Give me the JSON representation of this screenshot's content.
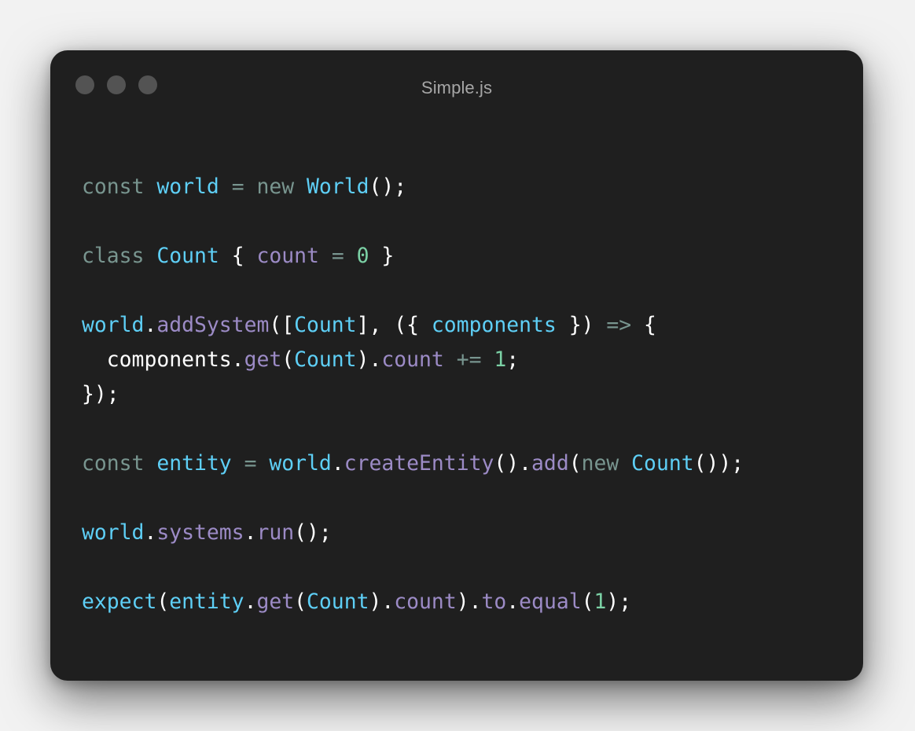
{
  "window": {
    "title": "Simple.js",
    "traffic_lights": [
      "close",
      "minimize",
      "zoom"
    ]
  },
  "colors": {
    "background": "#f2f2f2",
    "window": "#1f1f1f",
    "traffic_light": "#535353",
    "title": "#a6a6a6",
    "keyword": "#78958f",
    "operator": "#78958f",
    "variable": "#5ecff6",
    "property": "#9c8bc6",
    "number": "#7bd1a5",
    "punctuation": "#ffffff"
  },
  "code": {
    "language": "javascript",
    "lines": [
      [
        [
          "kw",
          "const"
        ],
        [
          "pl",
          " "
        ],
        [
          "vr",
          "world"
        ],
        [
          "pl",
          " "
        ],
        [
          "op",
          "="
        ],
        [
          "pl",
          " "
        ],
        [
          "kw",
          "new"
        ],
        [
          "pl",
          " "
        ],
        [
          "vr",
          "World"
        ],
        [
          "pn",
          "();"
        ]
      ],
      [],
      [
        [
          "kw",
          "class"
        ],
        [
          "pl",
          " "
        ],
        [
          "vr",
          "Count"
        ],
        [
          "pl",
          " "
        ],
        [
          "pn",
          "{"
        ],
        [
          "pl",
          " "
        ],
        [
          "pr",
          "count"
        ],
        [
          "pl",
          " "
        ],
        [
          "op",
          "="
        ],
        [
          "pl",
          " "
        ],
        [
          "nm",
          "0"
        ],
        [
          "pl",
          " "
        ],
        [
          "pn",
          "}"
        ]
      ],
      [],
      [
        [
          "vr",
          "world"
        ],
        [
          "pn",
          "."
        ],
        [
          "pr",
          "addSystem"
        ],
        [
          "pn",
          "(["
        ],
        [
          "vr",
          "Count"
        ],
        [
          "pn",
          "],"
        ],
        [
          "pl",
          " "
        ],
        [
          "pn",
          "({"
        ],
        [
          "pl",
          " "
        ],
        [
          "vr",
          "components"
        ],
        [
          "pl",
          " "
        ],
        [
          "pn",
          "})"
        ],
        [
          "pl",
          " "
        ],
        [
          "op",
          "=>"
        ],
        [
          "pl",
          " "
        ],
        [
          "pn",
          "{"
        ]
      ],
      [
        [
          "pl",
          "  components"
        ],
        [
          "pn",
          "."
        ],
        [
          "pr",
          "get"
        ],
        [
          "pn",
          "("
        ],
        [
          "vr",
          "Count"
        ],
        [
          "pn",
          ")."
        ],
        [
          "pr",
          "count"
        ],
        [
          "pl",
          " "
        ],
        [
          "op",
          "+="
        ],
        [
          "pl",
          " "
        ],
        [
          "nm",
          "1"
        ],
        [
          "pn",
          ";"
        ]
      ],
      [
        [
          "pn",
          "});"
        ]
      ],
      [],
      [
        [
          "kw",
          "const"
        ],
        [
          "pl",
          " "
        ],
        [
          "vr",
          "entity"
        ],
        [
          "pl",
          " "
        ],
        [
          "op",
          "="
        ],
        [
          "pl",
          " "
        ],
        [
          "vr",
          "world"
        ],
        [
          "pn",
          "."
        ],
        [
          "pr",
          "createEntity"
        ],
        [
          "pn",
          "()."
        ],
        [
          "pr",
          "add"
        ],
        [
          "pn",
          "("
        ],
        [
          "kw",
          "new"
        ],
        [
          "pl",
          " "
        ],
        [
          "vr",
          "Count"
        ],
        [
          "pn",
          "());"
        ]
      ],
      [],
      [
        [
          "vr",
          "world"
        ],
        [
          "pn",
          "."
        ],
        [
          "pr",
          "systems"
        ],
        [
          "pn",
          "."
        ],
        [
          "pr",
          "run"
        ],
        [
          "pn",
          "();"
        ]
      ],
      [],
      [
        [
          "vr",
          "expect"
        ],
        [
          "pn",
          "("
        ],
        [
          "vr",
          "entity"
        ],
        [
          "pn",
          "."
        ],
        [
          "pr",
          "get"
        ],
        [
          "pn",
          "("
        ],
        [
          "vr",
          "Count"
        ],
        [
          "pn",
          ")."
        ],
        [
          "pr",
          "count"
        ],
        [
          "pn",
          ")."
        ],
        [
          "pr",
          "to"
        ],
        [
          "pn",
          "."
        ],
        [
          "pr",
          "equal"
        ],
        [
          "pn",
          "("
        ],
        [
          "nm",
          "1"
        ],
        [
          "pn",
          ");"
        ]
      ]
    ]
  }
}
